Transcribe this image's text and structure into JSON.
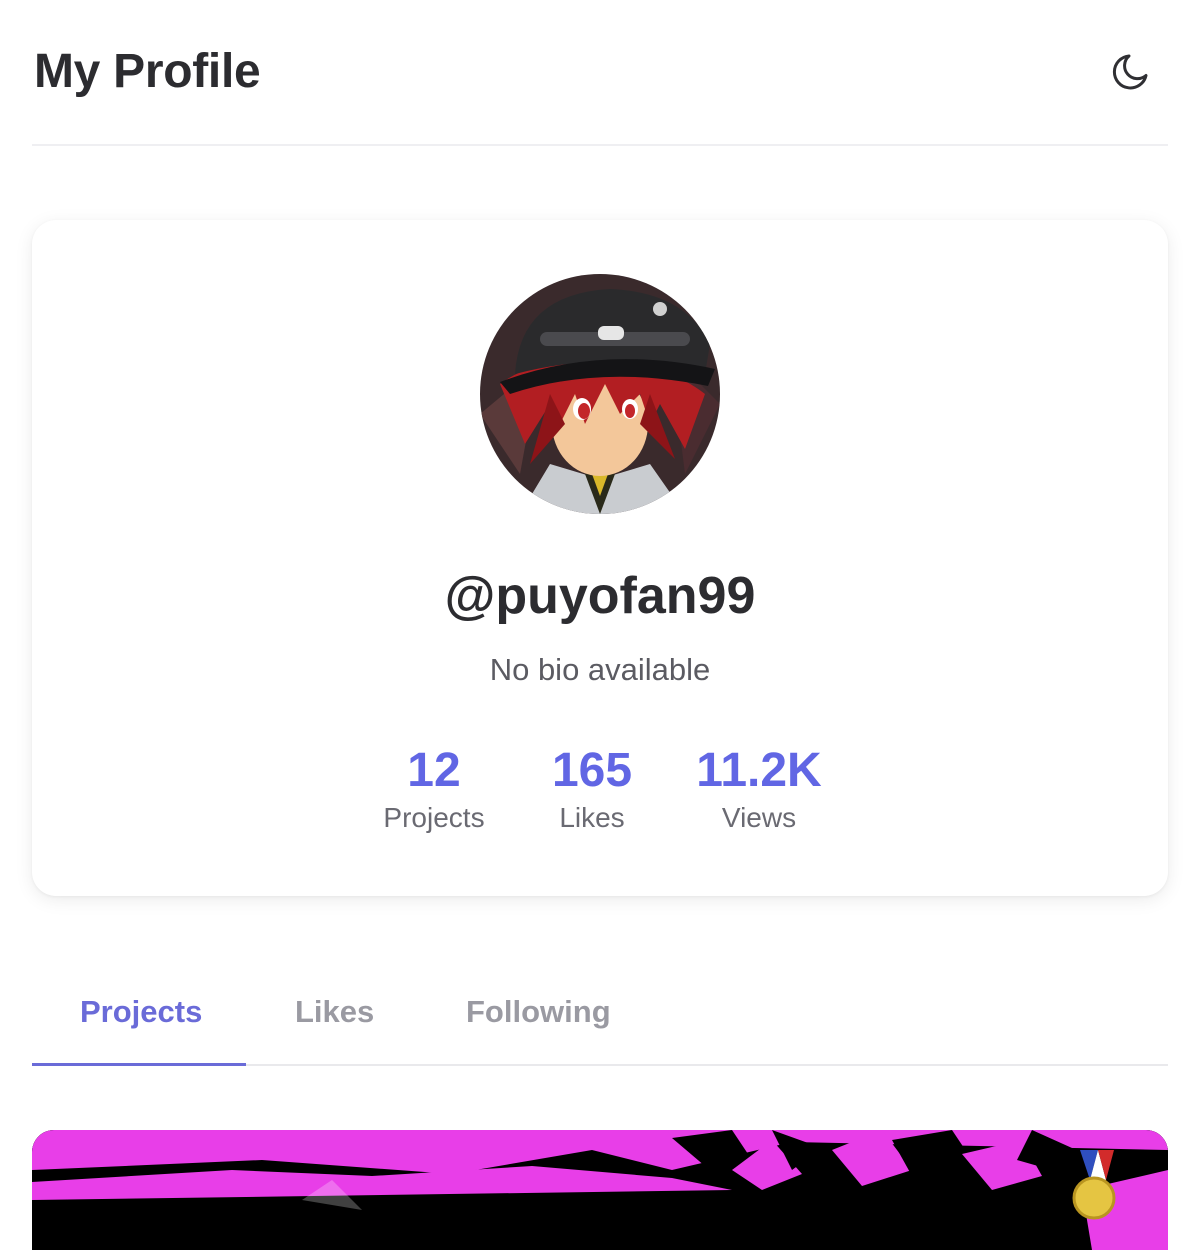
{
  "header": {
    "title": "My Profile",
    "theme_icon": "moon-icon"
  },
  "profile": {
    "username": "@puyofan99",
    "bio": "No bio available",
    "stats": [
      {
        "value": "12",
        "label": "Projects"
      },
      {
        "value": "165",
        "label": "Likes"
      },
      {
        "value": "11.2K",
        "label": "Views"
      }
    ]
  },
  "tabs": [
    {
      "label": "Projects",
      "active": true
    },
    {
      "label": "Likes",
      "active": false
    },
    {
      "label": "Following",
      "active": false
    }
  ],
  "colors": {
    "accent": "#6166e4",
    "tab_active": "#6a6bd8",
    "tab_inactive": "#9a9aa2",
    "project_magenta": "#e83ee8"
  }
}
